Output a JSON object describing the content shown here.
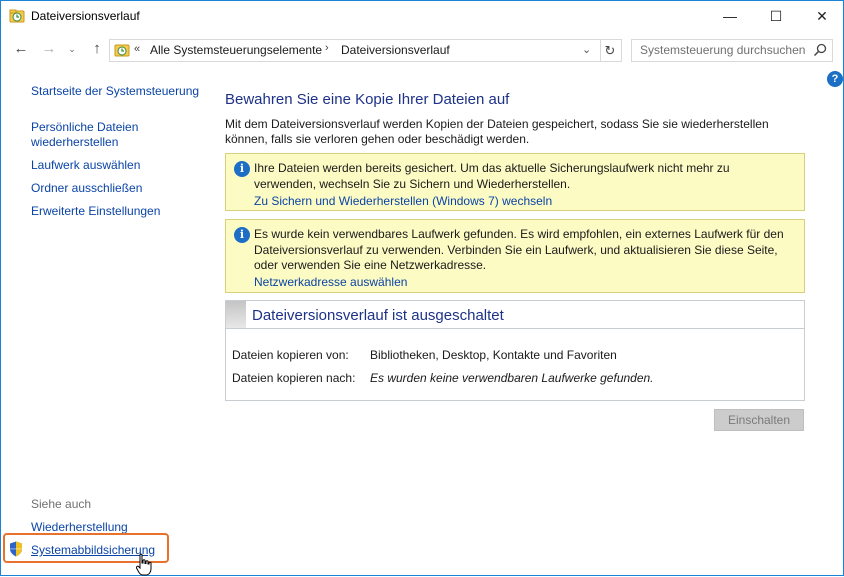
{
  "window": {
    "title": "Dateiversionsverlauf",
    "controls": {
      "minimize": "—",
      "maximize": "☐",
      "close": "✕"
    }
  },
  "navigation": {
    "back": "←",
    "forward": "→",
    "recent": "⌄",
    "up": "↑",
    "breadcrumb_chevron": "«",
    "breadcrumb": [
      "Alle Systemsteuerungselemente",
      "Dateiversionsverlauf"
    ],
    "breadcrumb_arrow": "›",
    "dropdown": "⌄",
    "refresh": "↻",
    "search_placeholder": "Systemsteuerung durchsuchen"
  },
  "help": "?",
  "sidebar": {
    "links": [
      "Startseite der Systemsteuerung",
      "Persönliche Dateien wiederherstellen",
      "Laufwerk auswählen",
      "Ordner ausschließen",
      "Erweiterte Einstellungen"
    ],
    "see_also_title": "Siehe auch",
    "see_also_links": [
      "Wiederherstellung",
      "Systemabbildsicherung"
    ]
  },
  "main": {
    "heading": "Bewahren Sie eine Kopie Ihrer Dateien auf",
    "description": "Mit dem Dateiversionsverlauf werden Kopien der Dateien gespeichert, sodass Sie sie wiederherstellen können, falls sie verloren gehen oder beschädigt werden.",
    "info_icon": "i",
    "notices": [
      {
        "text": "Ihre Dateien werden bereits gesichert. Um das aktuelle Sicherungslaufwerk nicht mehr zu verwenden, wechseln Sie zu Sichern und Wiederherstellen.",
        "link": "Zu Sichern und Wiederherstellen (Windows 7) wechseln"
      },
      {
        "text": "Es wurde kein verwendbares Laufwerk gefunden. Es wird empfohlen, ein externes Laufwerk für den Dateiversionsverlauf zu verwenden. Verbinden Sie ein Laufwerk, und aktualisieren Sie diese Seite, oder verwenden Sie eine Netzwerkadresse.",
        "link": "Netzwerkadresse auswählen"
      }
    ],
    "status": {
      "title": "Dateiversionsverlauf ist ausgeschaltet",
      "rows": [
        {
          "label": "Dateien kopieren von:",
          "value": "Bibliotheken, Desktop, Kontakte und Favoriten"
        },
        {
          "label": "Dateien kopieren nach:",
          "value": "Es wurden keine verwendbaren Laufwerke gefunden."
        }
      ]
    },
    "enable_button": "Einschalten"
  },
  "colors": {
    "accent_border": "#1883d7",
    "link": "#0a44a6",
    "heading": "#1e3287",
    "notice_bg": "#fdfbc4",
    "highlight": "#e8722c"
  }
}
